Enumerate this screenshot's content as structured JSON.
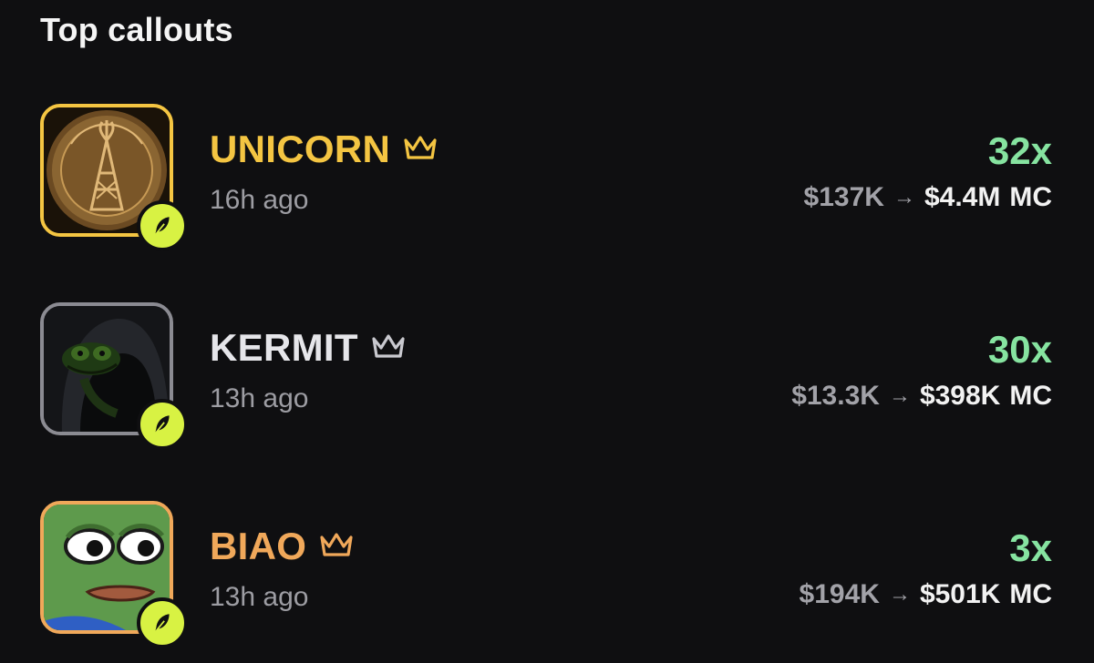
{
  "header": {
    "title": "Top callouts"
  },
  "colors": {
    "background": "#0f0f11",
    "unicorn_accent": "#f4c542",
    "kermit_accent": "#c9c9cf",
    "biao_accent": "#f0a85a",
    "multiplier_green": "#86e3a0",
    "badge_lime": "#d8f243"
  },
  "callouts": [
    {
      "name": "UNICORN",
      "time": "16h ago",
      "multiplier": "32x",
      "mc_from": "$137K",
      "arrow": "→",
      "mc_to": "$4.4M",
      "mc_unit": "MC",
      "avatar_icon": "oil-rig-coin-avatar",
      "crown_icon": "crown-icon",
      "badge_icon": "feather-icon"
    },
    {
      "name": "KERMIT",
      "time": "13h ago",
      "multiplier": "30x",
      "mc_from": "$13.3K",
      "arrow": "→",
      "mc_to": "$398K",
      "mc_unit": "MC",
      "avatar_icon": "hooded-frog-avatar",
      "crown_icon": "crown-icon",
      "badge_icon": "feather-icon"
    },
    {
      "name": "BIAO",
      "time": "13h ago",
      "multiplier": "3x",
      "mc_from": "$194K",
      "arrow": "→",
      "mc_to": "$501K",
      "mc_unit": "MC",
      "avatar_icon": "pepe-frog-avatar",
      "crown_icon": "crown-icon",
      "badge_icon": "feather-icon"
    }
  ]
}
